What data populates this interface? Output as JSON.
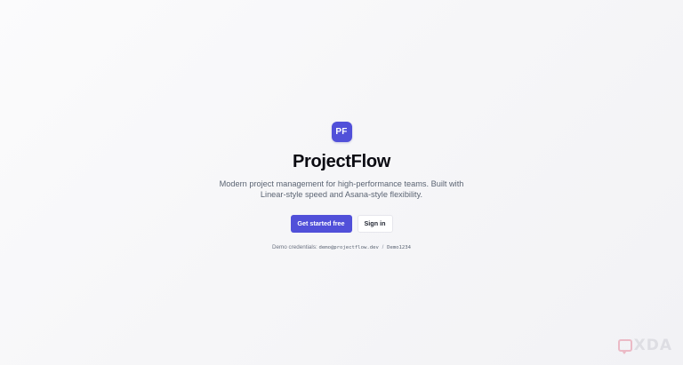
{
  "brand": {
    "logo_initials": "PF",
    "name": "ProjectFlow",
    "accent_color": "#5150d9"
  },
  "hero": {
    "tagline": "Modern project management for high-performance teams. Built with Linear-style speed and Asana-style flexibility."
  },
  "actions": {
    "primary_label": "Get started free",
    "secondary_label": "Sign in"
  },
  "demo": {
    "label": "Demo credentials:",
    "email": "demo@projectflow.dev",
    "separator": "/",
    "password": "Demo1234"
  },
  "watermark": {
    "text": "XDA"
  }
}
